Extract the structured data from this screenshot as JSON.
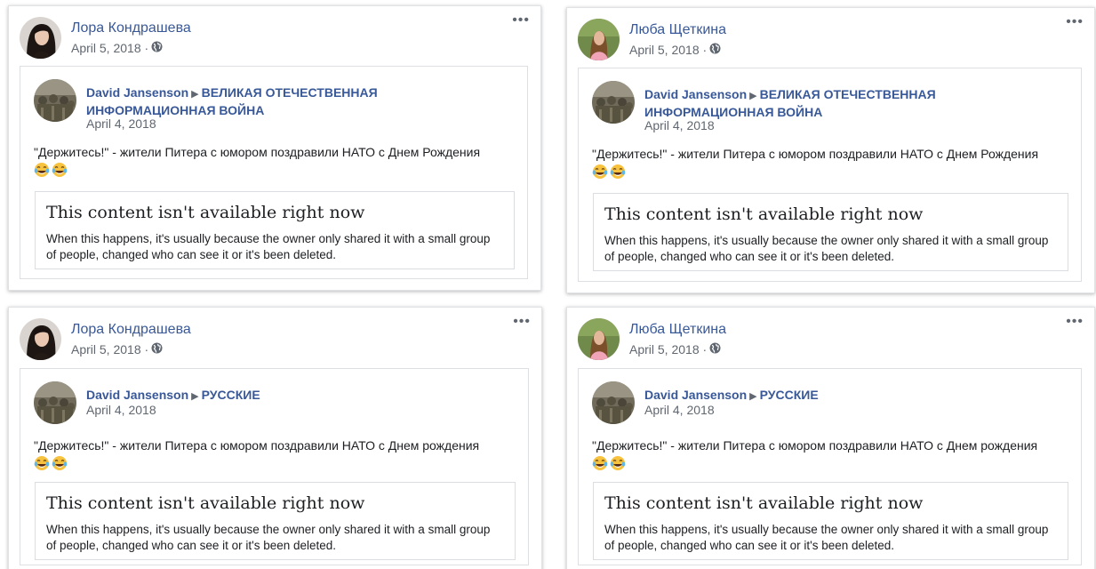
{
  "posts": [
    {
      "author": "Лора Кондрашева",
      "date": "April 5, 2018 ·",
      "shared": {
        "author": "David Jansenson",
        "group": "ВЕЛИКАЯ ОТЕЧЕСТВЕННАЯ ИНФОРМАЦИОННАЯ ВОЙНА",
        "date": "April 4, 2018",
        "text": "\"Держитесь!\" - жители Питера с юмором поздравили НАТО с Днем Рождения"
      },
      "unavailable": {
        "title": "This content isn't available right now",
        "body": "When this happens, it's usually because the owner only shared it with a small group of people, changed who can see it or it's been deleted."
      }
    },
    {
      "author": "Люба Щеткина",
      "date": "April 5, 2018 ·",
      "shared": {
        "author": "David Jansenson",
        "group": "ВЕЛИКАЯ ОТЕЧЕСТВЕННАЯ ИНФОРМАЦИОННАЯ ВОЙНА",
        "date": "April 4, 2018",
        "text": "\"Держитесь!\" - жители Питера с юмором поздравили НАТО с Днем Рождения"
      },
      "unavailable": {
        "title": "This content isn't available right now",
        "body": "When this happens, it's usually because the owner only shared it with a small group of people, changed who can see it or it's been deleted."
      }
    },
    {
      "author": "Лора Кондрашева",
      "date": "April 5, 2018 ·",
      "shared": {
        "author": "David Jansenson",
        "group": "РУССКИЕ",
        "date": "April 4, 2018",
        "text": "\"Держитесь!\" - жители Питера с юмором поздравили НАТО с Днем рождения"
      },
      "unavailable": {
        "title": "This content isn't available right now",
        "body": "When this happens, it's usually because the owner only shared it with a small group of people, changed who can see it or it's been deleted."
      }
    },
    {
      "author": "Люба Щеткина",
      "date": "April 5, 2018 ·",
      "shared": {
        "author": "David Jansenson",
        "group": "РУССКИЕ",
        "date": "April 4, 2018",
        "text": "\"Держитесь!\" - жители Питера с юмором поздравили НАТО с Днем рождения"
      },
      "unavailable": {
        "title": "This content isn't available right now",
        "body": "When this happens, it's usually because the owner only shared it with a small group of people, changed who can see it or it's been deleted."
      }
    }
  ],
  "icons": {
    "more": "more-options-icon",
    "privacy": "globe-icon",
    "emoji": "tears-of-joy-emoji"
  },
  "colors": {
    "link": "#385898",
    "meta": "#606770",
    "text": "#1c1e21",
    "border": "#dddfe2"
  }
}
